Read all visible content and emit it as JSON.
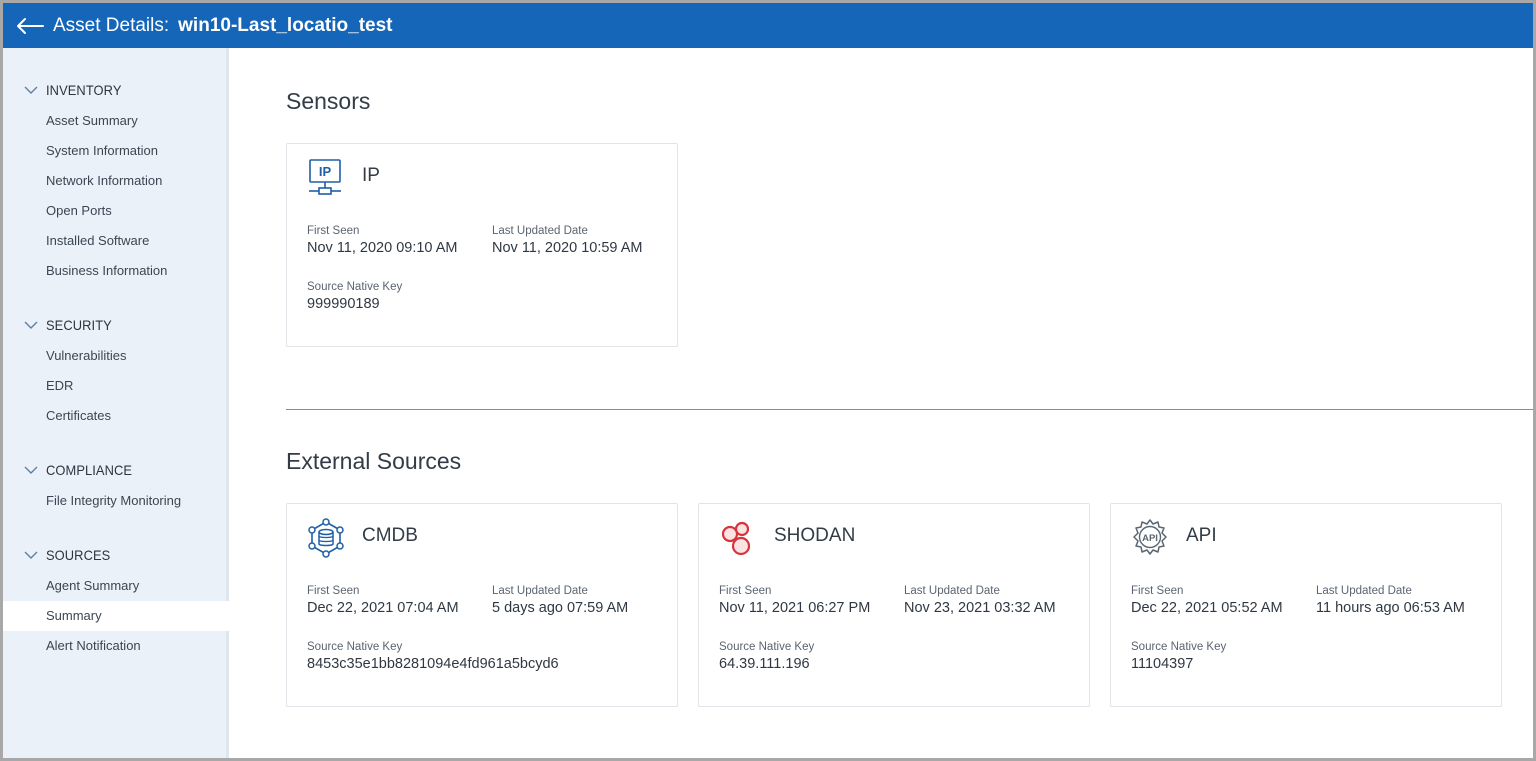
{
  "header": {
    "label": "Asset Details:",
    "asset_name": "win10-Last_locatio_test"
  },
  "sidebar": {
    "groups": [
      {
        "title": "INVENTORY",
        "items": [
          "Asset Summary",
          "System Information",
          "Network Information",
          "Open Ports",
          "Installed Software",
          "Business Information"
        ]
      },
      {
        "title": "SECURITY",
        "items": [
          "Vulnerabilities",
          "EDR",
          "Certificates"
        ]
      },
      {
        "title": "COMPLIANCE",
        "items": [
          "File Integrity Monitoring"
        ]
      },
      {
        "title": "SOURCES",
        "items": [
          "Agent Summary",
          "Summary",
          "Alert Notification"
        ]
      }
    ],
    "active_item": "Summary"
  },
  "sensors": {
    "title": "Sensors",
    "cards": [
      {
        "icon": "ip-network-icon",
        "name": "IP",
        "first_seen_label": "First Seen",
        "first_seen": "Nov 11, 2020 09:10 AM",
        "last_updated_label": "Last Updated Date",
        "last_updated": "Nov 11, 2020 10:59 AM",
        "key_label": "Source Native Key",
        "key": "999990189"
      }
    ]
  },
  "external": {
    "title": "External Sources",
    "cards": [
      {
        "icon": "cmdb-database-icon",
        "name": "CMDB",
        "first_seen_label": "First Seen",
        "first_seen": "Dec 22, 2021 07:04 AM",
        "last_updated_label": "Last Updated Date",
        "last_updated": "5 days ago 07:59 AM",
        "key_label": "Source Native Key",
        "key": "8453c35e1bb8281094e4fd961a5bcyd6"
      },
      {
        "icon": "shodan-icon",
        "name": "SHODAN",
        "first_seen_label": "First Seen",
        "first_seen": "Nov 11, 2021 06:27 PM",
        "last_updated_label": "Last Updated Date",
        "last_updated": "Nov 23, 2021 03:32 AM",
        "key_label": "Source Native Key",
        "key": "64.39.111.196"
      },
      {
        "icon": "api-gear-icon",
        "name": "API",
        "first_seen_label": "First Seen",
        "first_seen": "Dec 22, 2021 05:52 AM",
        "last_updated_label": "Last Updated Date",
        "last_updated": "11 hours ago 06:53 AM",
        "key_label": "Source Native Key",
        "key": "11104397"
      }
    ]
  },
  "colors": {
    "header_bg": "#1565b8",
    "sidebar_bg": "#eaf1f9",
    "icon_blue": "#1f5fa8",
    "shodan_red": "#d8343c"
  }
}
